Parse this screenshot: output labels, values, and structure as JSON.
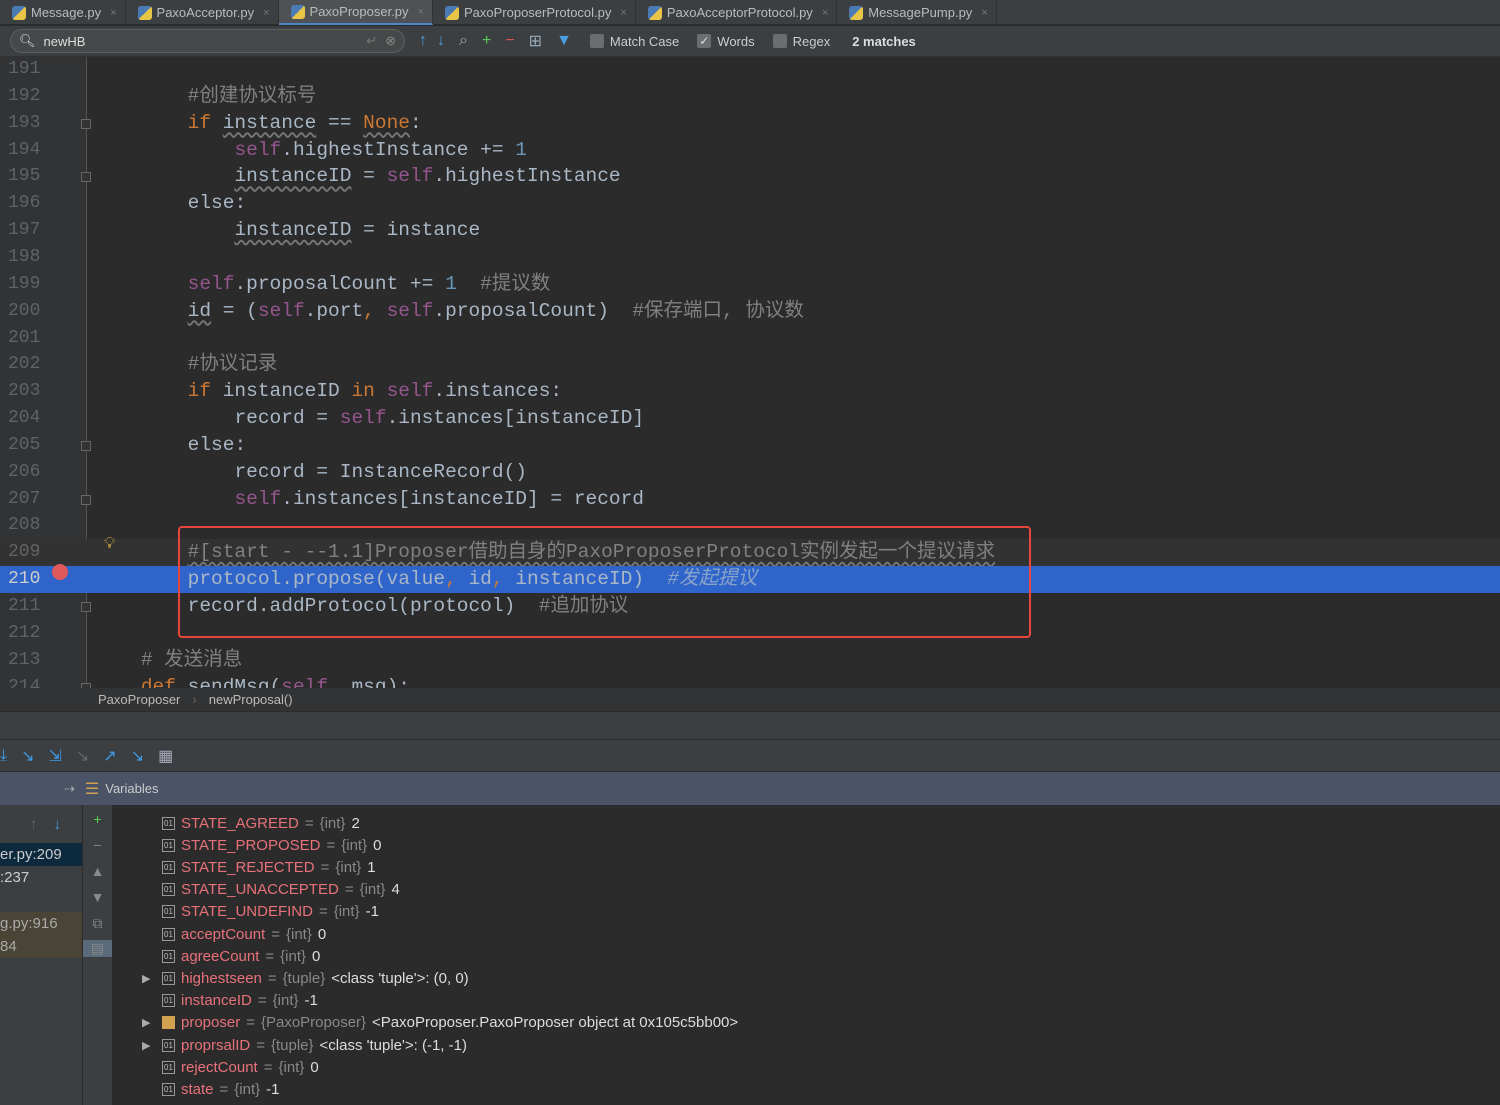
{
  "tabs": [
    {
      "label": "Message.py"
    },
    {
      "label": "PaxoAcceptor.py"
    },
    {
      "label": "PaxoProposer.py",
      "active": true
    },
    {
      "label": "PaxoProposerProtocol.py"
    },
    {
      "label": "PaxoAcceptorProtocol.py"
    },
    {
      "label": "MessagePump.py"
    }
  ],
  "search": {
    "value": "newHB",
    "match_case": false,
    "words": true,
    "regex": false,
    "match_case_label": "Match Case",
    "words_label": "Words",
    "regex_label": "Regex",
    "matches": "2 matches"
  },
  "editor": {
    "lines": [
      {
        "n": "191",
        "t": []
      },
      {
        "n": "192",
        "t": [
          [
            "        ",
            ""
          ],
          [
            "#创建协议标号",
            "cm"
          ]
        ]
      },
      {
        "n": "193",
        "t": [
          [
            "        ",
            ""
          ],
          [
            "if ",
            "kw"
          ],
          [
            "instance",
            "ul"
          ],
          [
            " == ",
            ""
          ],
          [
            "None",
            "kw ul"
          ],
          [
            ":",
            ""
          ]
        ]
      },
      {
        "n": "194",
        "t": [
          [
            "            ",
            ""
          ],
          [
            "self",
            "sf"
          ],
          [
            ".highestInstance += ",
            ""
          ],
          [
            "1",
            "nm"
          ]
        ]
      },
      {
        "n": "195",
        "t": [
          [
            "            ",
            ""
          ],
          [
            "instanceID",
            "ul"
          ],
          [
            " = ",
            ""
          ],
          [
            "self",
            "sf"
          ],
          [
            ".highestInstance",
            ""
          ]
        ]
      },
      {
        "n": "196",
        "t": [
          [
            "        ",
            ""
          ],
          [
            "else",
            ""
          ],
          [
            ":",
            ""
          ]
        ]
      },
      {
        "n": "197",
        "t": [
          [
            "            ",
            ""
          ],
          [
            "instanceID",
            "ul"
          ],
          [
            " = instance",
            ""
          ]
        ]
      },
      {
        "n": "198",
        "t": []
      },
      {
        "n": "199",
        "t": [
          [
            "        ",
            ""
          ],
          [
            "self",
            "sf"
          ],
          [
            ".proposalCount += ",
            ""
          ],
          [
            "1",
            "nm"
          ],
          [
            "  #提议数",
            "cm"
          ]
        ]
      },
      {
        "n": "200",
        "t": [
          [
            "        ",
            ""
          ],
          [
            "id",
            "ul"
          ],
          [
            " = (",
            ""
          ],
          [
            "self",
            "sf"
          ],
          [
            ".port",
            ""
          ],
          [
            ", ",
            "kw"
          ],
          [
            "self",
            "sf"
          ],
          [
            ".proposalCount)  ",
            ""
          ],
          [
            "#保存端口, 协议数",
            "cm"
          ]
        ]
      },
      {
        "n": "201",
        "t": []
      },
      {
        "n": "202",
        "t": [
          [
            "        ",
            ""
          ],
          [
            "#协议记录",
            "cm"
          ]
        ]
      },
      {
        "n": "203",
        "t": [
          [
            "        ",
            ""
          ],
          [
            "if ",
            "kw"
          ],
          [
            "instanceID ",
            ""
          ],
          [
            "in ",
            "kw"
          ],
          [
            "self",
            "sf"
          ],
          [
            ".instances:",
            ""
          ]
        ]
      },
      {
        "n": "204",
        "t": [
          [
            "            ",
            ""
          ],
          [
            "record = ",
            ""
          ],
          [
            "self",
            "sf"
          ],
          [
            ".instances[instanceID]",
            ""
          ]
        ]
      },
      {
        "n": "205",
        "t": [
          [
            "        ",
            ""
          ],
          [
            "else",
            ""
          ],
          [
            ":",
            ""
          ]
        ]
      },
      {
        "n": "206",
        "t": [
          [
            "            ",
            ""
          ],
          [
            "record = InstanceRecord()",
            ""
          ]
        ]
      },
      {
        "n": "207",
        "t": [
          [
            "            ",
            ""
          ],
          [
            "self",
            "sf"
          ],
          [
            ".instances[instanceID] = record",
            ""
          ]
        ]
      },
      {
        "n": "208",
        "t": []
      },
      {
        "n": "209",
        "t": [
          [
            "        ",
            ""
          ],
          [
            "#[start - --1.1]Proposer借助自身的PaxoProposerProtocol实例发起一个提议请求",
            "cm ul"
          ]
        ]
      },
      {
        "n": "210",
        "t": [
          [
            "        ",
            ""
          ],
          [
            "protocol.propose(value",
            ""
          ],
          [
            ", ",
            "kw"
          ],
          [
            "id",
            ""
          ],
          [
            ", ",
            "kw"
          ],
          [
            "instanceID)  ",
            ""
          ],
          [
            "#发起提议",
            "cmi"
          ]
        ]
      },
      {
        "n": "211",
        "t": [
          [
            "        ",
            ""
          ],
          [
            "record.addProtocol(protocol)  ",
            ""
          ],
          [
            "#追加协议",
            "cm"
          ]
        ]
      },
      {
        "n": "212",
        "t": []
      },
      {
        "n": "213",
        "t": [
          [
            "    ",
            ""
          ],
          [
            "# 发送消息",
            "cm"
          ]
        ]
      },
      {
        "n": "214",
        "t": [
          [
            "    ",
            ""
          ],
          [
            "def ",
            "kw"
          ],
          [
            "sendMsg(",
            ""
          ],
          [
            "self",
            "sf"
          ],
          [
            ", msg):...",
            ""
          ]
        ]
      }
    ]
  },
  "breadcrumb": [
    "PaxoProposer",
    "newProposal()"
  ],
  "debugger": {
    "panel_title": "Variables",
    "frames": [
      {
        "label": "er.py:209",
        "selected": true
      },
      {
        "label": ":237"
      },
      {
        "label": ""
      },
      {
        "label": "g.py:916",
        "lib": true
      },
      {
        "label": "84",
        "lib": true
      }
    ],
    "variables": [
      {
        "name": "STATE_AGREED",
        "type": "{int}",
        "value": "2"
      },
      {
        "name": "STATE_PROPOSED",
        "type": "{int}",
        "value": "0"
      },
      {
        "name": "STATE_REJECTED",
        "type": "{int}",
        "value": "1"
      },
      {
        "name": "STATE_UNACCEPTED",
        "type": "{int}",
        "value": "4"
      },
      {
        "name": "STATE_UNDEFIND",
        "type": "{int}",
        "value": "-1"
      },
      {
        "name": "acceptCount",
        "type": "{int}",
        "value": "0"
      },
      {
        "name": "agreeCount",
        "type": "{int}",
        "value": "0"
      },
      {
        "name": "highestseen",
        "type": "{tuple}",
        "value": "<class 'tuple'>: (0, 0)",
        "expandable": true
      },
      {
        "name": "instanceID",
        "type": "{int}",
        "value": "-1"
      },
      {
        "name": "proposer",
        "type": "{PaxoProposer}",
        "value": "<PaxoProposer.PaxoProposer object at 0x105c5bb00>",
        "expandable": true,
        "obj": true
      },
      {
        "name": "proprsalID",
        "type": "{tuple}",
        "value": "<class 'tuple'>: (-1, -1)",
        "expandable": true
      },
      {
        "name": "rejectCount",
        "type": "{int}",
        "value": "0"
      },
      {
        "name": "state",
        "type": "{int}",
        "value": "-1"
      }
    ]
  }
}
